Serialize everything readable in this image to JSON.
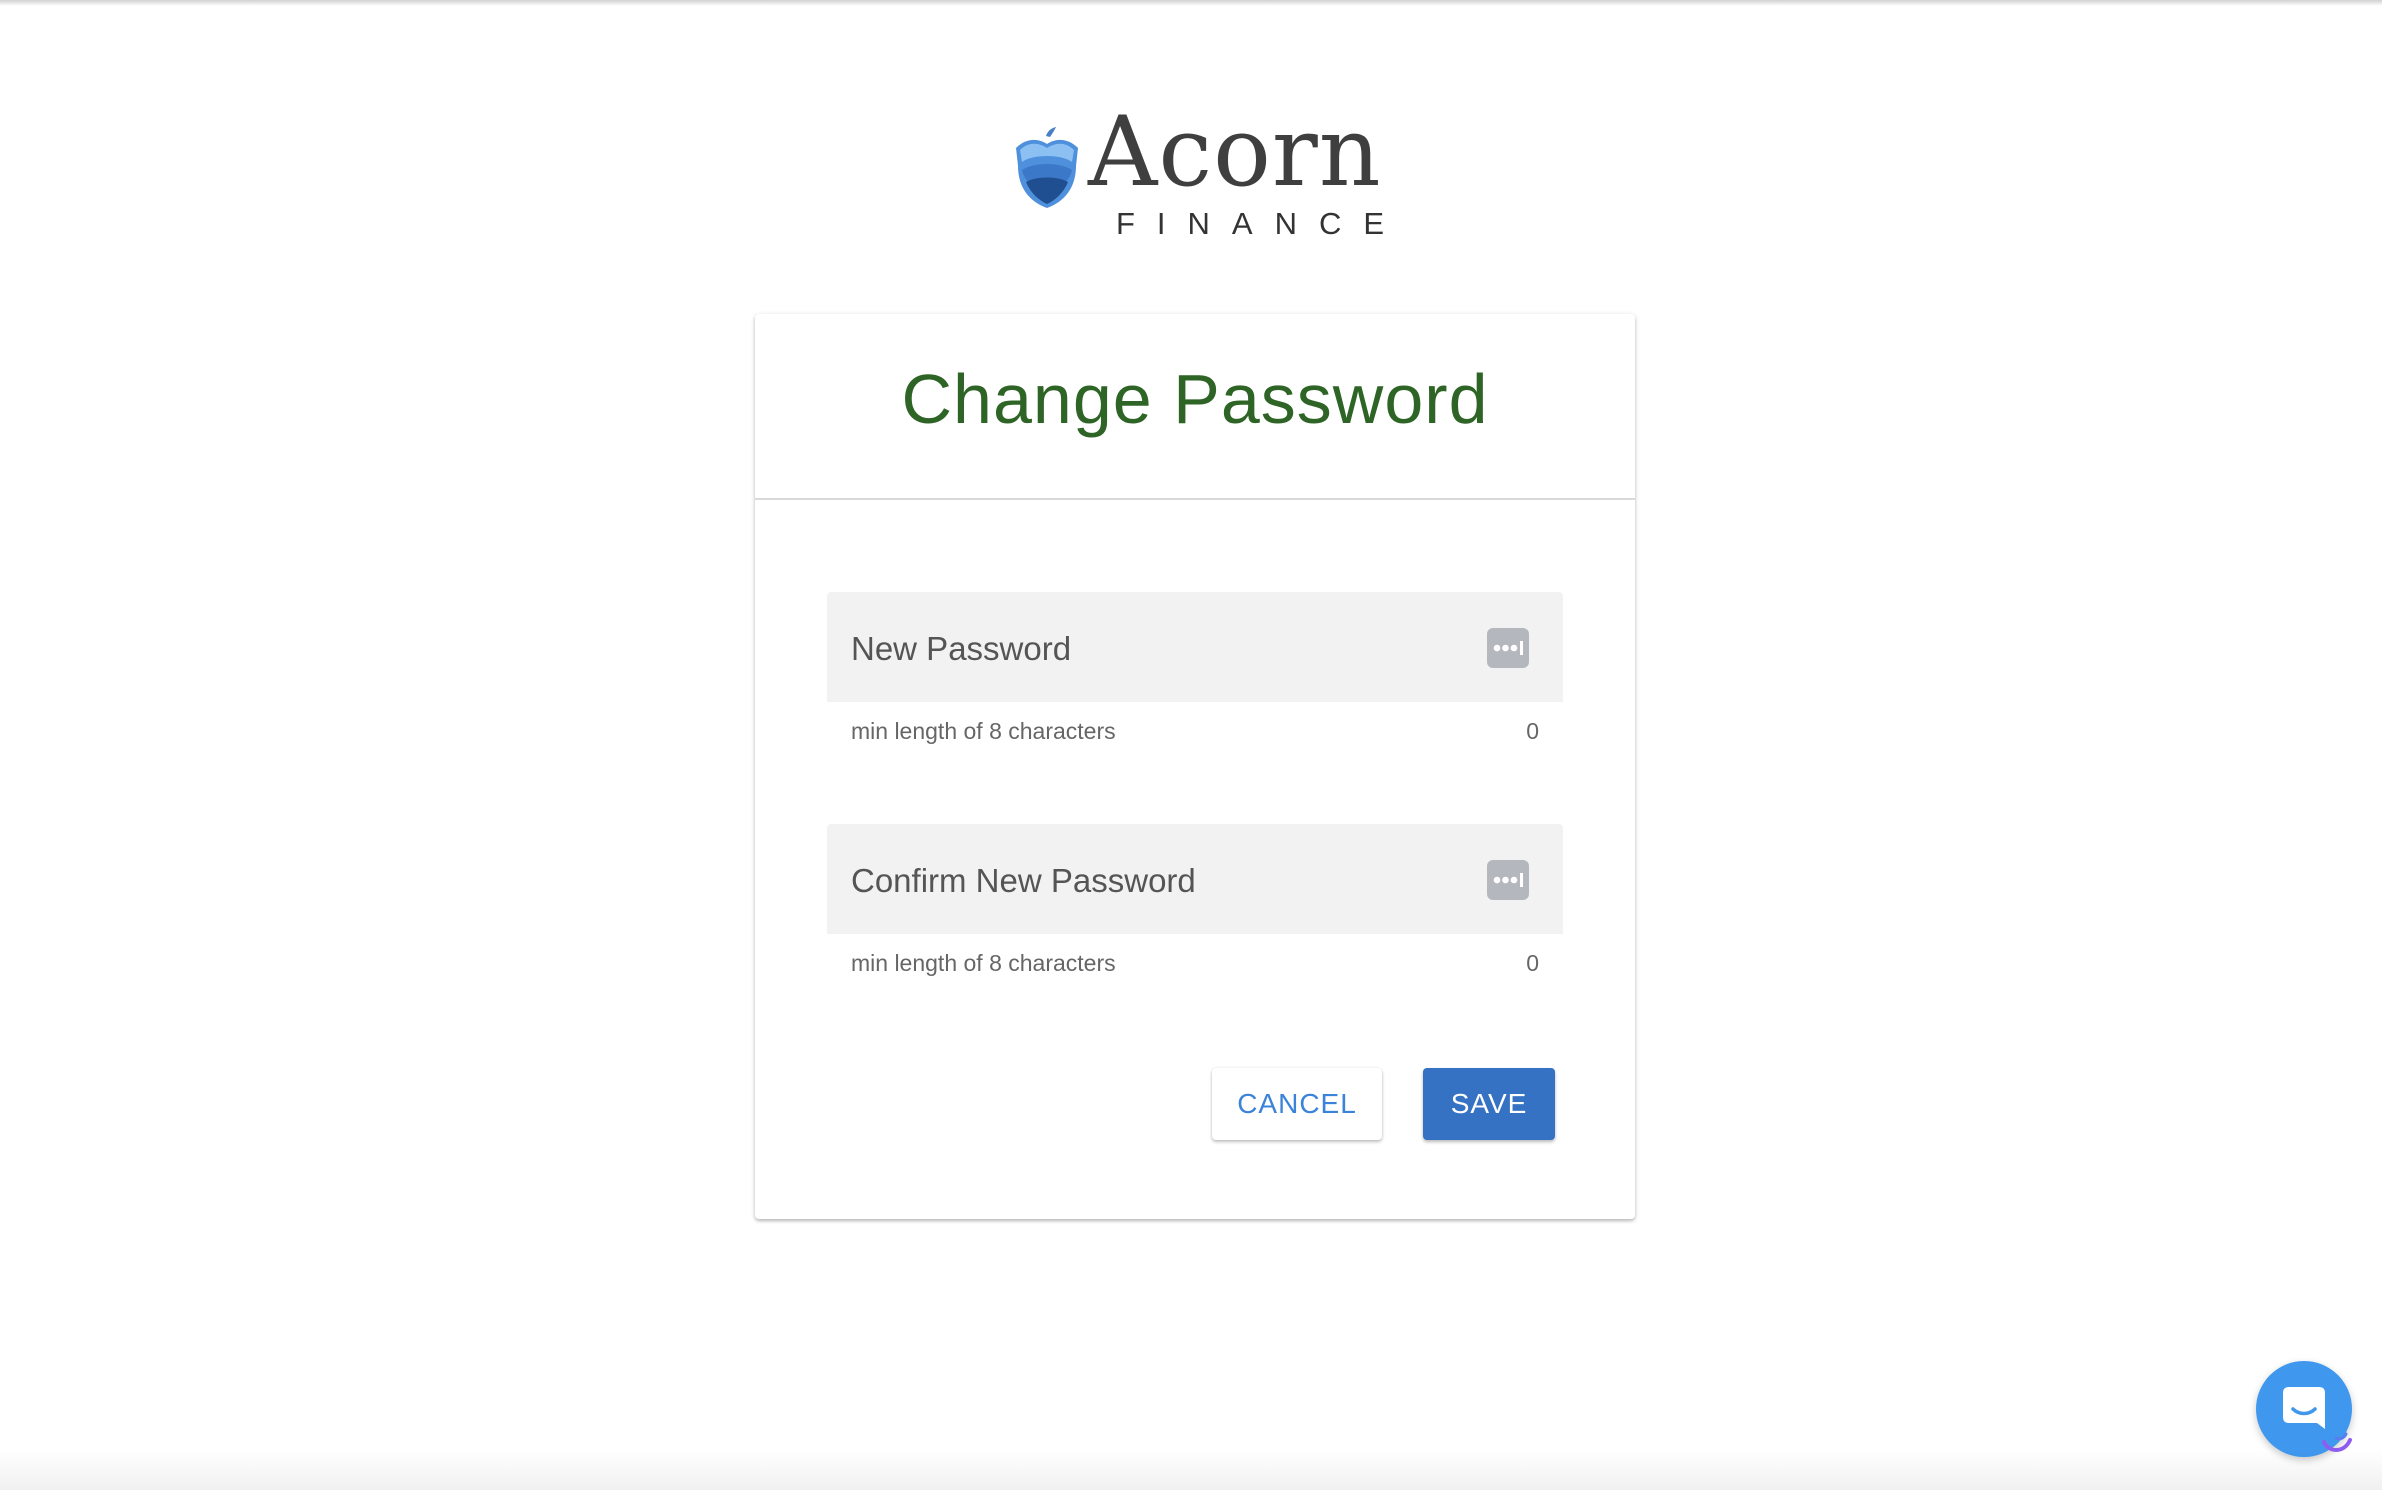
{
  "logo": {
    "word": "Acorn",
    "sub": "FINANCE",
    "mark_icon": "acorn-logo-icon"
  },
  "form": {
    "title": "Change Password",
    "fields": [
      {
        "label": "New Password",
        "hint": "min length of 8 characters",
        "count": "0",
        "icon": "password-manager-icon"
      },
      {
        "label": "Confirm New Password",
        "hint": "min length of 8 characters",
        "count": "0",
        "icon": "password-manager-icon"
      }
    ],
    "cancel_label": "CANCEL",
    "save_label": "SAVE"
  },
  "chat": {
    "icon": "chat-icon"
  },
  "colors": {
    "title": "#2e6425",
    "primary": "#3572c4",
    "link": "#3a83d8",
    "field_bg": "#f2f2f2",
    "chat": "#3f98ee"
  }
}
